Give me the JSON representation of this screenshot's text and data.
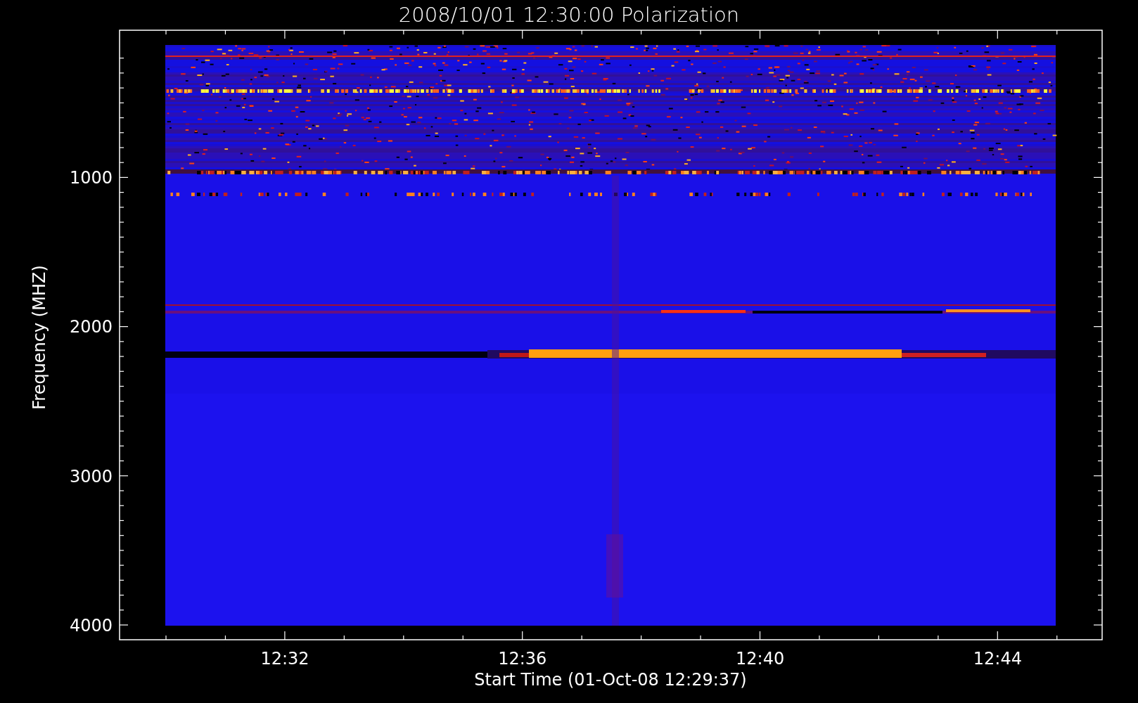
{
  "title": "2008/10/01 12:30:00 Polarization",
  "y_axis": {
    "label": "Frequency (MHZ)",
    "ticks": [
      "1000",
      "2000",
      "3000",
      "4000"
    ]
  },
  "x_axis": {
    "label": "Start Time (01-Oct-08 12:29:37)",
    "ticks": [
      "12:32",
      "12:36",
      "12:40",
      "12:44"
    ]
  }
}
